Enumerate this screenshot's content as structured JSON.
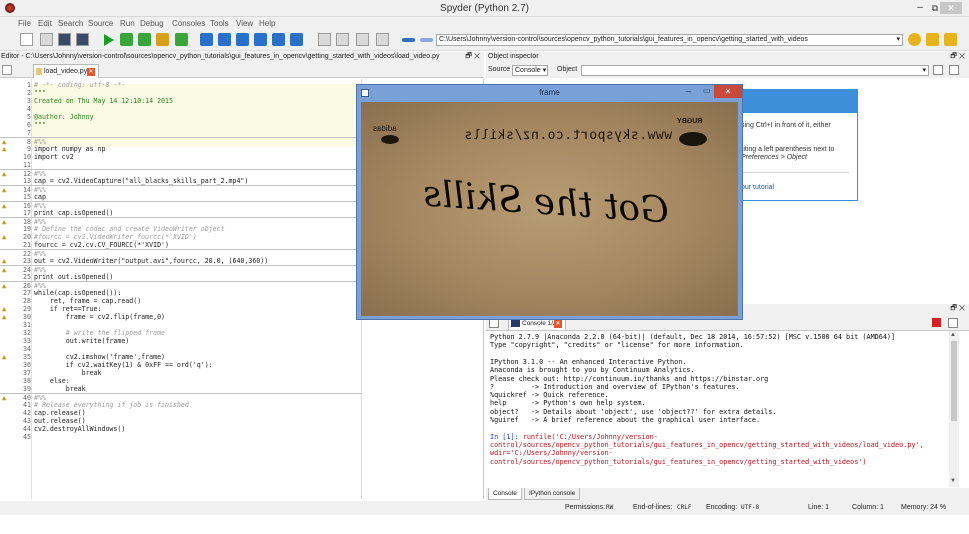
{
  "window": {
    "title": "Spyder (Python 2.7)",
    "min": "–",
    "max": "⧉",
    "close": "✕"
  },
  "menu": [
    "File",
    "Edit",
    "Search",
    "Source",
    "Run",
    "Debug",
    "Consoles",
    "Tools",
    "View",
    "Help"
  ],
  "toolbar": {
    "path": "C:\\Users\\Johnny\\version-control\\sources\\opencv_python_tutorials\\gui_features_in_opencv\\getting_started_with_videos",
    "path_arrow": "▾"
  },
  "editor": {
    "header": "Editor - C:\\Users\\Johnny\\version-control\\sources\\opencv_python_tutorials\\gui_features_in_opencv\\getting_started_with_videos\\load_video.py",
    "header_ctrl": "🗗 ✕",
    "tab": "load_video.py",
    "tab_close": "✕",
    "lines": [
      {
        "n": "1",
        "t": "# -*- coding: utf-8 -*-",
        "c": "c-com"
      },
      {
        "n": "2",
        "t": "\"\"\"",
        "c": "c-doc"
      },
      {
        "n": "3",
        "t": "Created on Thu May 14 12:10:14 2015",
        "c": "c-doc"
      },
      {
        "n": "4",
        "t": "",
        "c": "c-doc"
      },
      {
        "n": "5",
        "t": "@author: Johnny",
        "c": "c-doc"
      },
      {
        "n": "6",
        "t": "\"\"\"",
        "c": "c-doc"
      },
      {
        "n": "7",
        "t": "",
        "c": "c-def"
      },
      {
        "n": "8",
        "t": "#%%",
        "c": "c-com",
        "w": true,
        "sep": true
      },
      {
        "n": "9",
        "t": "import numpy as np",
        "c": "c-def",
        "w": true
      },
      {
        "n": "10",
        "t": "import cv2",
        "c": "c-def"
      },
      {
        "n": "11",
        "t": "",
        "c": "c-def"
      },
      {
        "n": "12",
        "t": "#%%",
        "c": "c-com",
        "w": true,
        "sep": true
      },
      {
        "n": "13",
        "t": "cap = cv2.VideoCapture(\"all_blacks_skills_part_2.mp4\")",
        "c": "c-def"
      },
      {
        "n": "14",
        "t": "#%%",
        "c": "c-com",
        "w": true,
        "sep": true
      },
      {
        "n": "15",
        "t": "cap",
        "c": "c-def"
      },
      {
        "n": "16",
        "t": "#%%",
        "c": "c-com",
        "w": true,
        "sep": true
      },
      {
        "n": "17",
        "t": "print cap.isOpened()",
        "c": "c-def"
      },
      {
        "n": "18",
        "t": "#%%",
        "c": "c-com",
        "w": true,
        "sep": true
      },
      {
        "n": "19",
        "t": "# Define the codec and create VideoWriter object",
        "c": "c-com"
      },
      {
        "n": "20",
        "t": "#fourcc = cv2.VideoWriter_fourcc(*'XVID')",
        "c": "c-com",
        "w": true
      },
      {
        "n": "21",
        "t": "fourcc = cv2.cv.CV_FOURCC(*'XVID')",
        "c": "c-def"
      },
      {
        "n": "22",
        "t": "#%%",
        "c": "c-com",
        "sep": true
      },
      {
        "n": "23",
        "t": "out = cv2.VideoWriter(\"output.avi\",fourcc, 20.0, (640,360))",
        "c": "c-def",
        "w": true
      },
      {
        "n": "24",
        "t": "#%%",
        "c": "c-com",
        "w": true,
        "sep": true
      },
      {
        "n": "25",
        "t": "print out.isOpened()",
        "c": "c-def"
      },
      {
        "n": "26",
        "t": "#%%",
        "c": "c-com",
        "w": true,
        "sep": true
      },
      {
        "n": "27",
        "t": "while(cap.isOpened()):",
        "c": "c-def"
      },
      {
        "n": "28",
        "t": "    ret, frame = cap.read()",
        "c": "c-def"
      },
      {
        "n": "29",
        "t": "    if ret==True:",
        "c": "c-def",
        "w": true
      },
      {
        "n": "30",
        "t": "        frame = cv2.flip(frame,0)",
        "c": "c-def",
        "w": true
      },
      {
        "n": "31",
        "t": "",
        "c": "c-def"
      },
      {
        "n": "32",
        "t": "        # write the flipped frame",
        "c": "c-com"
      },
      {
        "n": "33",
        "t": "        out.write(frame)",
        "c": "c-def"
      },
      {
        "n": "34",
        "t": "",
        "c": "c-def"
      },
      {
        "n": "35",
        "t": "        cv2.imshow('frame',frame)",
        "c": "c-def",
        "w": true
      },
      {
        "n": "36",
        "t": "        if cv2.waitKey(1) & 0xFF == ord('q'):",
        "c": "c-def"
      },
      {
        "n": "37",
        "t": "            break",
        "c": "c-def"
      },
      {
        "n": "38",
        "t": "    else:",
        "c": "c-def"
      },
      {
        "n": "39",
        "t": "        break",
        "c": "c-def"
      },
      {
        "n": "40",
        "t": "#%%",
        "c": "c-com",
        "w": true,
        "sep": true
      },
      {
        "n": "41",
        "t": "# Release everything if job is finished",
        "c": "c-com"
      },
      {
        "n": "42",
        "t": "cap.release()",
        "c": "c-def"
      },
      {
        "n": "43",
        "t": "out.release()",
        "c": "c-def"
      },
      {
        "n": "44",
        "t": "cv2.destroyAllWindows()",
        "c": "c-def"
      },
      {
        "n": "45",
        "t": "",
        "c": "c-def"
      }
    ]
  },
  "inspector": {
    "header": "Object inspector",
    "header_ctrl": "🗗 ✕",
    "source_label": "Source",
    "source_value": "Console",
    "object_label": "Object",
    "help_lines": [
      "sing Ctrl+I in front of it, either",
      "",
      "riting a left parenthesis next to",
      "Preferences > Object",
      "",
      "our tutorial"
    ]
  },
  "frame_window": {
    "title": "frame",
    "min": "–",
    "max": "▭",
    "close": "✕",
    "image_text": {
      "url": "www.skysport.co.nz/skills",
      "big": "Got the Skills",
      "left_small": "adidas",
      "right_small": "RUGBY"
    }
  },
  "console": {
    "header_ctrl": "🗗 ✕",
    "tab": "Console 1/A",
    "tab_close": "✕",
    "lines": [
      {
        "t": "Python 2.7.9 |Anaconda 2.2.0 (64-bit)| (default, Dec 18 2014, 16:57:52) [MSC v.1500 64 bit (AMD64)]",
        "c": ""
      },
      {
        "t": "Type \"copyright\", \"credits\" or \"license\" for more information.",
        "c": ""
      },
      {
        "t": "",
        "c": ""
      },
      {
        "t": "IPython 3.1.0 -- An enhanced Interactive Python.",
        "c": ""
      },
      {
        "t": "Anaconda is brought to you by Continuum Analytics.",
        "c": ""
      },
      {
        "t": "Please check out: http://continuum.io/thanks and https://binstar.org",
        "c": ""
      },
      {
        "t": "?         -> Introduction and overview of IPython's features.",
        "c": ""
      },
      {
        "t": "%quickref -> Quick reference.",
        "c": ""
      },
      {
        "t": "help      -> Python's own help system.",
        "c": ""
      },
      {
        "t": "object?   -> Details about 'object', use 'object??' for extra details.",
        "c": ""
      },
      {
        "t": "%guiref   -> A brief reference about the graphical user interface.",
        "c": ""
      },
      {
        "t": "",
        "c": ""
      },
      {
        "t": "In [1]: runfile('C:/Users/Johnny/version-",
        "c": "err",
        "p": "In [1]: "
      },
      {
        "t": "control/sources/opencv_python_tutorials/gui_features_in_opencv/getting_started_with_videos/load_video.py',",
        "c": "err"
      },
      {
        "t": "wdir='C:/Users/Johnny/version-",
        "c": "err"
      },
      {
        "t": "control/sources/opencv_python_tutorials/gui_features_in_opencv/getting_started_with_videos')",
        "c": "err"
      }
    ],
    "bottom_tabs": [
      "Console",
      "IPython console"
    ]
  },
  "status": {
    "permissions_label": "Permissions:",
    "permissions": "RW",
    "eol_label": "End-of-lines:",
    "eol": "CRLF",
    "encoding_label": "Encoding:",
    "encoding": "UTF-8",
    "line": "Line: 1",
    "column": "Column: 1",
    "memory": "Memory: 24 %"
  }
}
